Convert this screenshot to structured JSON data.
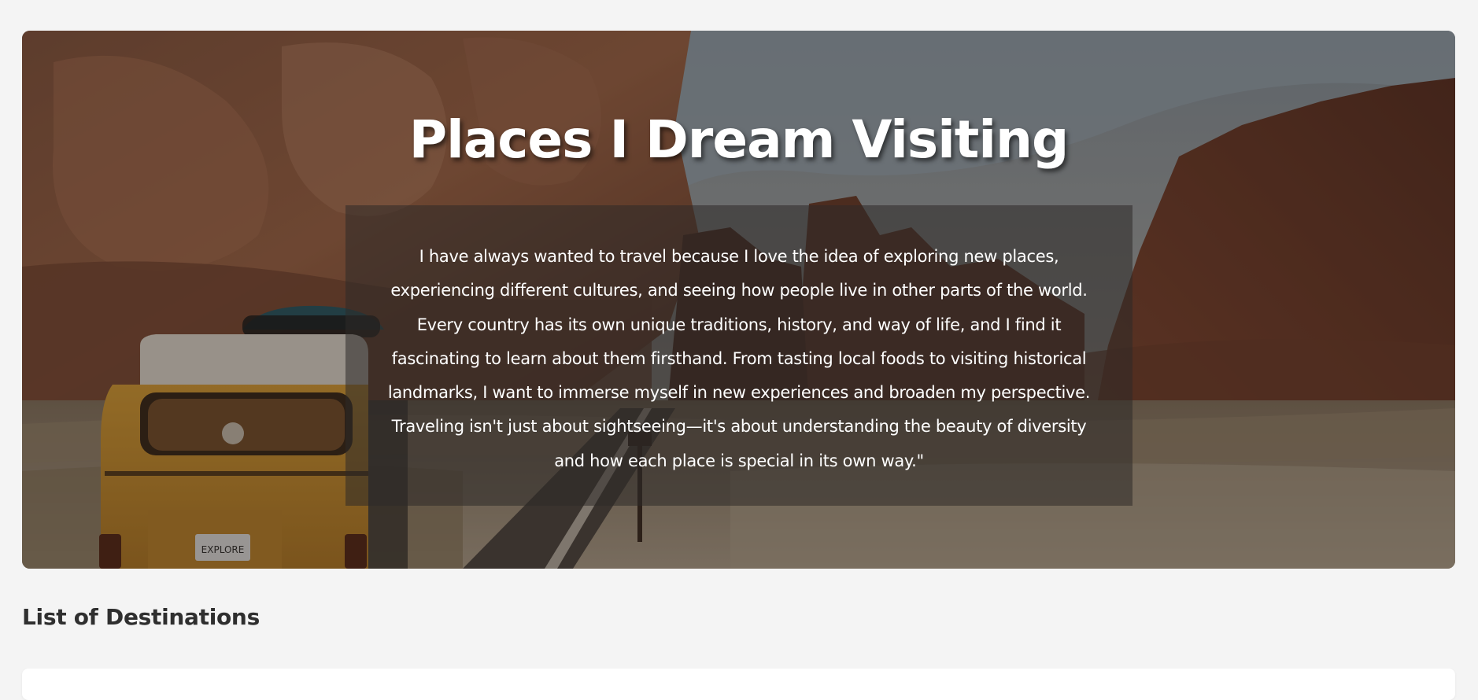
{
  "hero": {
    "title": "Places I Dream Visiting",
    "description": "I have always wanted to travel because I love the idea of exploring new places, experiencing different cultures, and seeing how people live in other parts of the world. Every country has its own unique traditions, history, and way of life, and I find it fascinating to learn about them firsthand. From tasting local foods to visiting historical landmarks, I want to immerse myself in new experiences and broaden my perspective. Traveling isn't just about sightseeing—it's about understanding the beauty of diversity and how each place is special in its own way.\"",
    "image_plate": "EXPLORE"
  },
  "destinations": {
    "heading": "List of Destinations"
  },
  "colors": {
    "page_background": "#f4f4f4",
    "heading_text": "#2f2f2f",
    "hero_text": "#ffffff"
  }
}
